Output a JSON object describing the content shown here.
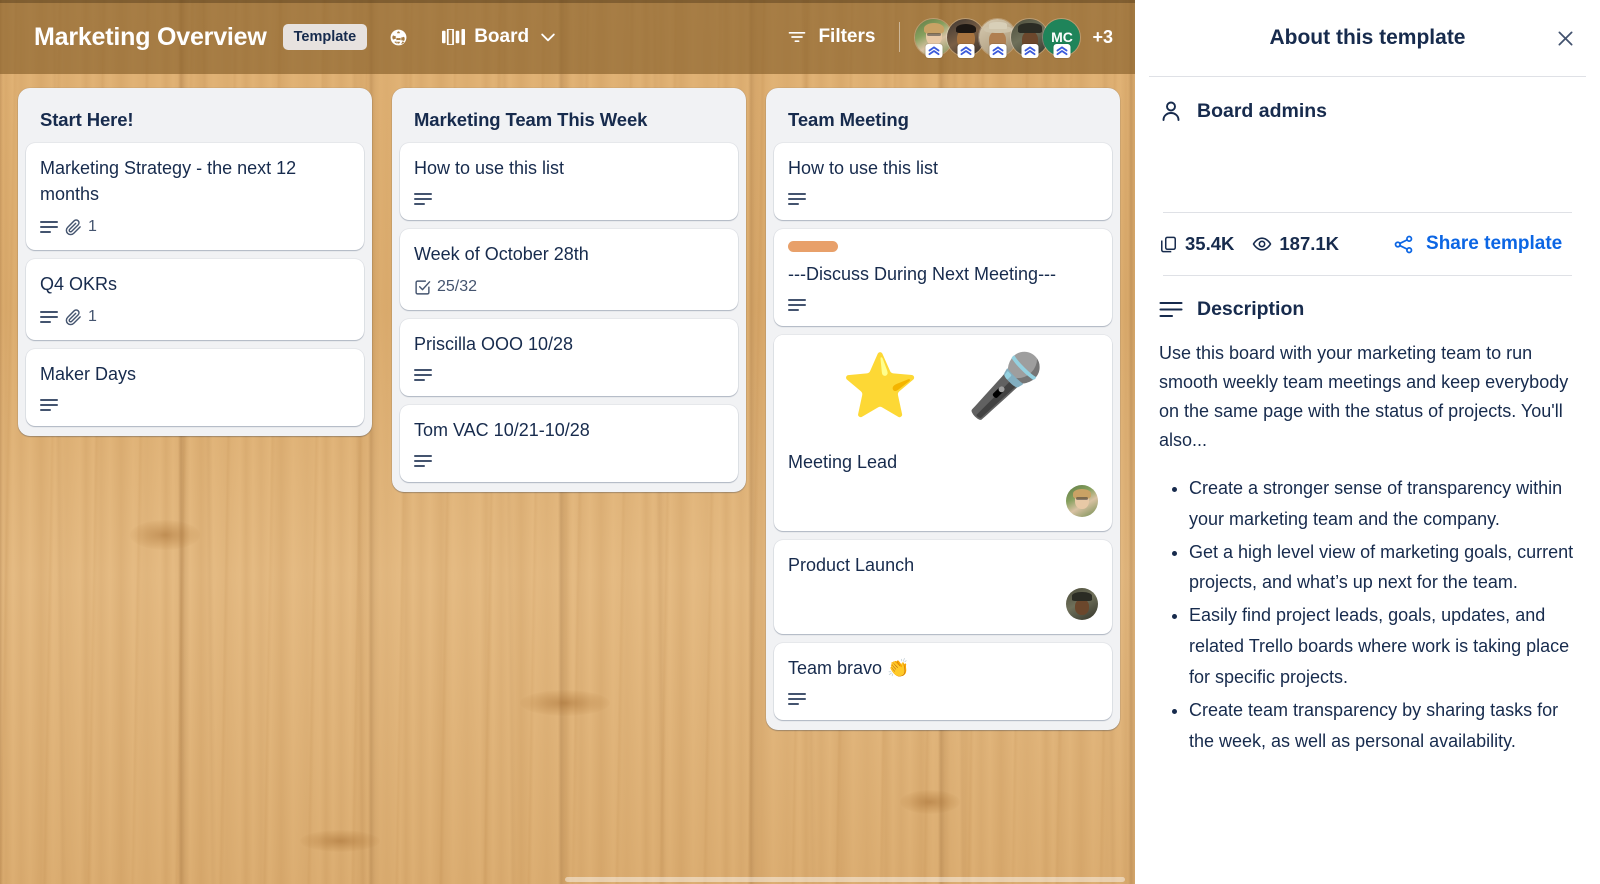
{
  "header": {
    "board_title": "Marketing Overview",
    "template_badge": "Template",
    "visibility_icon": "globe-icon",
    "view_icon": "board-view-icon",
    "view_label": "Board",
    "view_caret_icon": "chevron-down-icon",
    "filters_icon": "filter-icon",
    "filters_label": "Filters",
    "members": [
      {
        "name": "member-1",
        "type": "photo",
        "badge": "premium-badge-icon"
      },
      {
        "name": "member-2",
        "type": "photo",
        "badge": "premium-badge-icon"
      },
      {
        "name": "member-3",
        "type": "photo",
        "badge": "premium-badge-icon"
      },
      {
        "name": "member-4",
        "type": "photo",
        "badge": "premium-badge-icon"
      },
      {
        "name": "member-5",
        "type": "initials",
        "initials": "MC",
        "color": "#1f845a",
        "badge": "premium-badge-icon"
      }
    ],
    "members_overflow": "+3"
  },
  "lists": [
    {
      "title": "Start Here!",
      "cards": [
        {
          "title": "Marketing Strategy - the next 12 months",
          "badges": [
            {
              "icon": "description-icon",
              "text": ""
            },
            {
              "icon": "attachment-icon",
              "text": "1"
            }
          ]
        },
        {
          "title": "Q4 OKRs",
          "badges": [
            {
              "icon": "description-icon",
              "text": ""
            },
            {
              "icon": "attachment-icon",
              "text": "1"
            }
          ]
        },
        {
          "title": "Maker Days",
          "badges": [
            {
              "icon": "description-icon",
              "text": ""
            }
          ]
        }
      ]
    },
    {
      "title": "Marketing Team This Week",
      "cards": [
        {
          "title": "How to use this list",
          "badges": [
            {
              "icon": "description-icon",
              "text": ""
            }
          ]
        },
        {
          "title": "Week of October 28th",
          "badges": [
            {
              "icon": "checklist-icon",
              "text": "25/32"
            }
          ]
        },
        {
          "title": "Priscilla OOO 10/28",
          "badges": [
            {
              "icon": "description-icon",
              "text": ""
            }
          ]
        },
        {
          "title": "Tom VAC 10/21-10/28",
          "badges": [
            {
              "icon": "description-icon",
              "text": ""
            }
          ]
        }
      ]
    },
    {
      "title": "Team Meeting",
      "cards": [
        {
          "title": "How to use this list",
          "badges": [
            {
              "icon": "description-icon",
              "text": ""
            }
          ]
        },
        {
          "title": "---Discuss During Next Meeting---",
          "labels": [
            {
              "name": "orange-label",
              "color": "#e8a06a"
            }
          ],
          "badges": [
            {
              "icon": "description-icon",
              "text": ""
            }
          ]
        },
        {
          "title": "Meeting Lead",
          "cover": {
            "emojis": [
              "⭐",
              "🎤"
            ]
          },
          "badges": [],
          "members": [
            {
              "name": "card-member-avatar-1"
            }
          ]
        },
        {
          "title": "Product Launch",
          "badges": [],
          "members": [
            {
              "name": "card-member-avatar-2"
            }
          ]
        },
        {
          "title": "Team bravo 👏",
          "badges": [
            {
              "icon": "description-icon",
              "text": ""
            }
          ]
        }
      ]
    }
  ],
  "panel": {
    "title": "About this template",
    "close_icon": "close-icon",
    "admins": {
      "icon": "person-icon",
      "label": "Board admins"
    },
    "stats": [
      {
        "icon": "copy-icon",
        "value": "35.4K"
      },
      {
        "icon": "eye-icon",
        "value": "187.1K"
      }
    ],
    "share": {
      "icon": "share-icon",
      "label": "Share template",
      "color": "#0c66e4"
    },
    "description": {
      "icon": "description-icon",
      "heading": "Description",
      "paragraph": "Use this board with your marketing team to run smooth weekly team meetings and keep everybody on the same page with the status of projects. You'll also...",
      "bullets": [
        "Create a stronger sense of transparency within your marketing team and the company.",
        "Get a high level view of marketing goals, current projects, and what’s up next for the team.",
        "Easily find project leads, goals, updates, and related Trello boards where work is taking place for specific projects.",
        "Create team transparency by sharing tasks for the week, as well as personal availability."
      ]
    }
  }
}
